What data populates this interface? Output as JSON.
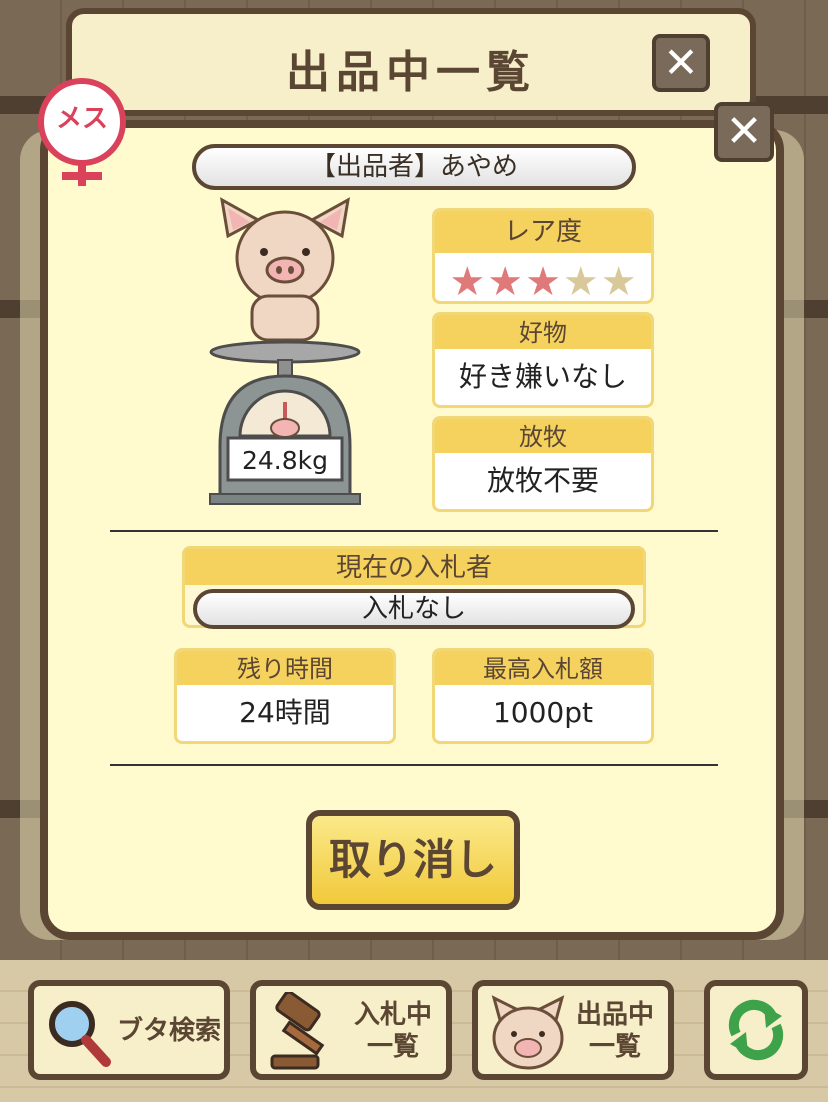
{
  "title": "出品中一覧",
  "close_icon": "close-icon",
  "gender": {
    "label": "メス",
    "icon": "female-icon",
    "color": "#d9425a"
  },
  "seller": {
    "label": "【出品者】あやめ"
  },
  "pig": {
    "weight": "24.8kg"
  },
  "rarity": {
    "label": "レア度",
    "filled": 3,
    "total": 5
  },
  "favorite": {
    "label": "好物",
    "value": "好き嫌いなし"
  },
  "grazing": {
    "label": "放牧",
    "value": "放牧不要"
  },
  "bidder": {
    "label": "現在の入札者",
    "value": "入札なし"
  },
  "time_left": {
    "label": "残り時間",
    "value": "24時間"
  },
  "highest_bid": {
    "label": "最高入札額",
    "value": "1000pt"
  },
  "cancel_button": "取り消し",
  "nav": {
    "search": "ブタ検索",
    "bidding_line1": "入札中",
    "bidding_line2": "一覧",
    "listing_line1": "出品中",
    "listing_line2": "一覧",
    "refresh_icon": "refresh-icon"
  },
  "colors": {
    "accent_yellow": "#f5d25e",
    "brown": "#5b4634",
    "star_filled": "#e07a7a",
    "star_empty": "#d9c99a"
  }
}
